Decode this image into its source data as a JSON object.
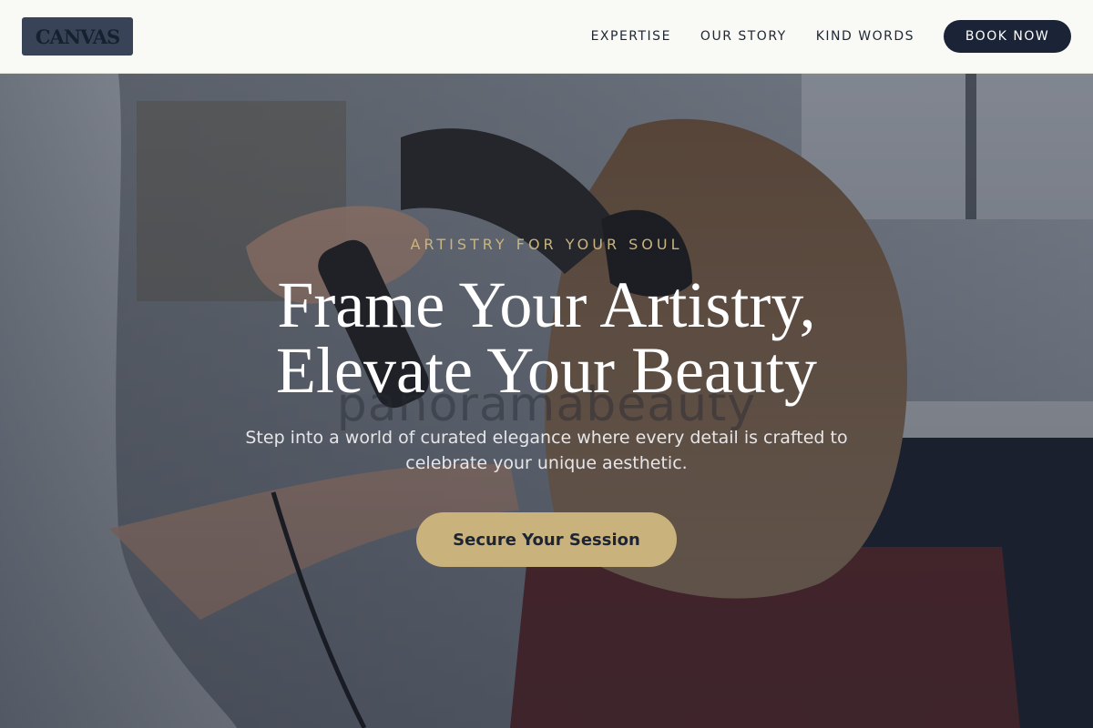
{
  "header": {
    "logo_text": "CANVAS",
    "nav": [
      {
        "label": "EXPERTISE"
      },
      {
        "label": "OUR STORY"
      },
      {
        "label": "KIND WORDS"
      }
    ],
    "book_label": "BOOK NOW"
  },
  "hero": {
    "eyebrow": "ARTISTRY FOR YOUR SOUL",
    "headline_line1": "Frame Your Artistry,",
    "headline_line2": "Elevate Your Beauty",
    "watermark": "panoramabeauty",
    "subtitle": "Step into a world of curated elegance where every detail is crafted to celebrate your unique aesthetic.",
    "cta_label": "Secure Your Session",
    "image_subject": "hairdresser blow-drying client's hair in salon"
  },
  "colors": {
    "header_bg": "#f9f9f6",
    "navy": "#1b2436",
    "gold": "#c9b27c",
    "eyebrow_gold": "#c9b47f",
    "logo_bg": "#384357"
  }
}
